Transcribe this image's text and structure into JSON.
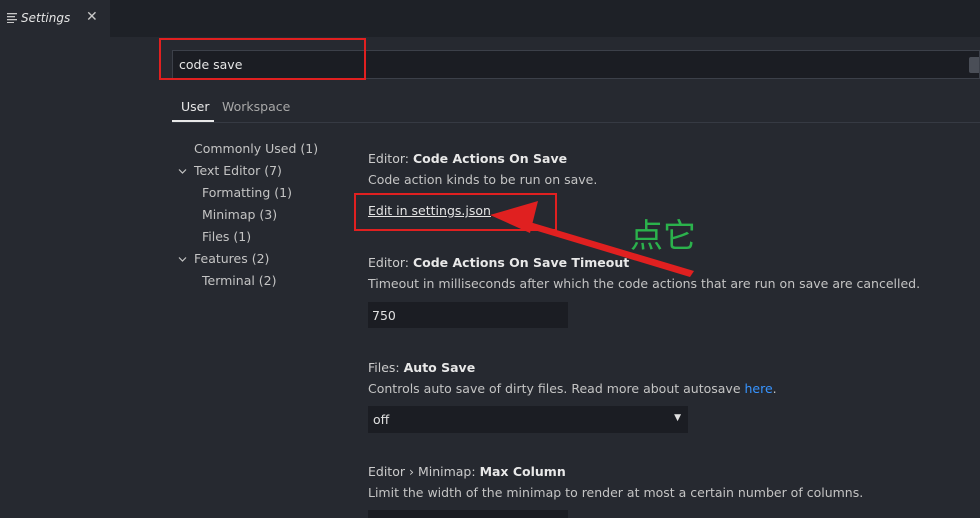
{
  "tab": {
    "label": "Settings",
    "close": "✕",
    "icon": "menu-lines-icon"
  },
  "search": {
    "value": "code save"
  },
  "scope_tabs": {
    "user": "User",
    "workspace": "Workspace"
  },
  "toc": {
    "commonly_used": "Commonly Used (1)",
    "text_editor": "Text Editor (7)",
    "formatting": "Formatting (1)",
    "minimap": "Minimap (3)",
    "files": "Files (1)",
    "features": "Features (2)",
    "terminal": "Terminal (2)"
  },
  "settings": {
    "code_actions": {
      "prefix": "Editor: ",
      "name": "Code Actions On Save",
      "description": "Code action kinds to be run on save.",
      "link": "Edit in settings.json"
    },
    "code_actions_timeout": {
      "prefix": "Editor: ",
      "name": "Code Actions On Save Timeout",
      "description": "Timeout in milliseconds after which the code actions that are run on save are cancelled.",
      "value": "750"
    },
    "auto_save": {
      "prefix": "Files: ",
      "name": "Auto Save",
      "description": "Controls auto save of dirty files. Read more about autosave ",
      "link": "here",
      "suffix": ".",
      "value": "off"
    },
    "max_column": {
      "prefix": "Editor › Minimap: ",
      "name": "Max Column",
      "description": "Limit the width of the minimap to render at most a certain number of columns."
    }
  },
  "annotation": {
    "text": "点它",
    "color": "#2bb24c",
    "box_color": "#e02020"
  }
}
